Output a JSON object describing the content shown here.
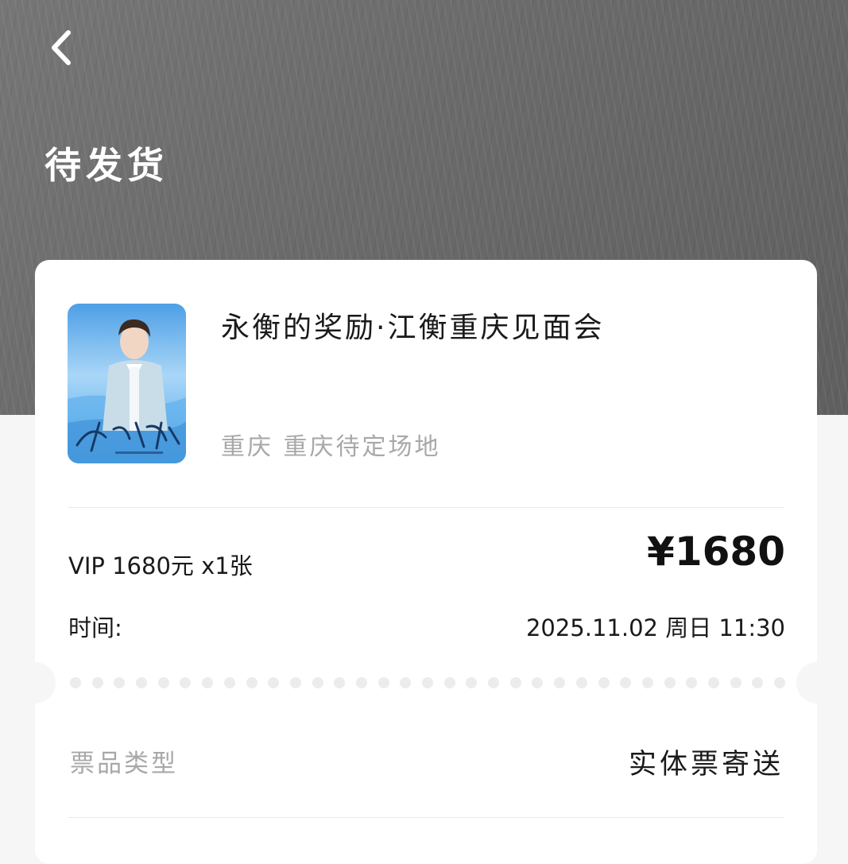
{
  "header": {
    "back_icon": "chevron-left-icon",
    "status_title": "待发货"
  },
  "event": {
    "poster_icon": "event-poster-image",
    "poster_caption": "永衡的奖励",
    "title": "永衡的奖励·江衡重庆见面会",
    "venue": "重庆  重庆待定场地"
  },
  "order": {
    "ticket_spec": "VIP 1680元 x1张",
    "price": "¥1680",
    "time_label": "时间:",
    "time_value": "2025.11.02  周日  11:30"
  },
  "delivery": {
    "type_label": "票品类型",
    "type_value": "实体票寄送"
  },
  "colors": {
    "header_bg": "#6e6e6e",
    "card_bg": "#ffffff",
    "muted_text": "#a8a8a8",
    "poster_sky": "#5aa9ec"
  }
}
